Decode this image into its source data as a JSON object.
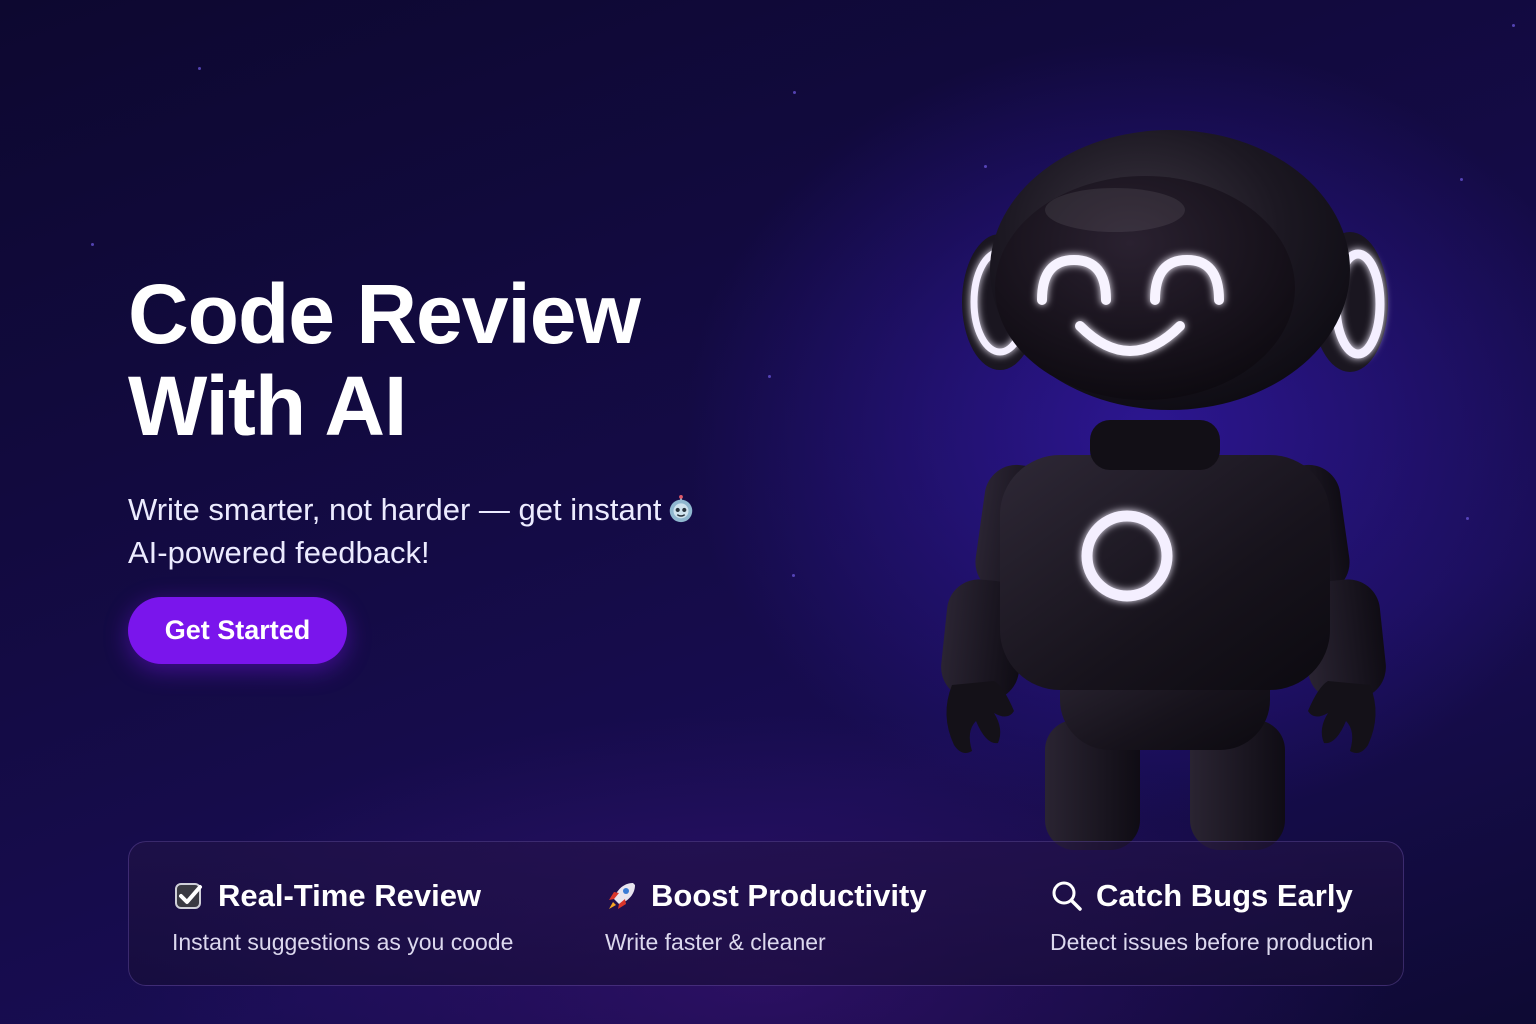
{
  "hero": {
    "title_line1": "Code Review",
    "title_line2": "With AI",
    "subtitle_line1": "Write smarter, not harder — get instant",
    "subtitle_line2": "AI-powered feedback!",
    "subtitle_icon": "robot-face-icon",
    "cta_label": "Get Started"
  },
  "features": [
    {
      "icon": "check-box-icon",
      "title": "Real-Time Review",
      "description": "Instant suggestions as you coode"
    },
    {
      "icon": "rocket-icon",
      "title": "Boost Productivity",
      "description": "Write faster & cleaner"
    },
    {
      "icon": "magnifier-icon",
      "title": "Catch Bugs Early",
      "description": "Detect issues before production"
    }
  ],
  "colors": {
    "background": "#130b42",
    "accent": "#7a15ec",
    "glow": "#f4efff",
    "robot_body": "#17131c"
  }
}
